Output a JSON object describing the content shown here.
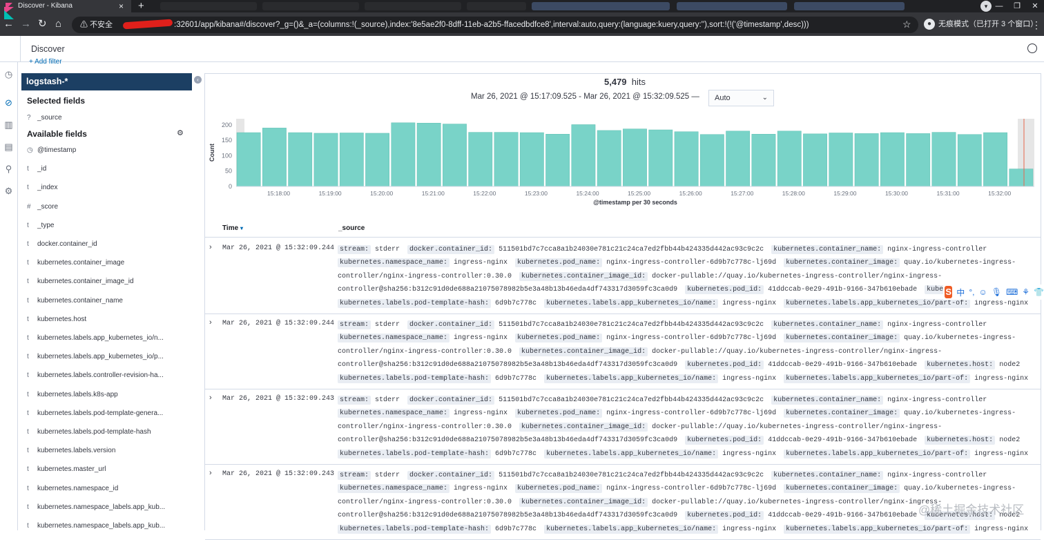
{
  "browser": {
    "tab_title": "Discover - Kibana",
    "tab_close": "×",
    "new_tab": "+",
    "window_controls": [
      "—",
      "❐",
      "✕"
    ],
    "insecure_label": "不安全",
    "url": ":32601/app/kibana#/discover?_g=()&_a=(columns:!(_source),index:'8e5ae2f0-8dff-11eb-a2b5-ffacedbdfce8',interval:auto,query:(language:kuery,query:''),sort:!(!('@timestamp',desc)))",
    "incognito_label": "无痕模式（已打开 3 个窗口）"
  },
  "app": {
    "page_title": "Discover",
    "add_filter": "+ Add filter",
    "index_pattern": "logstash-*"
  },
  "sidebar": {
    "selected_heading": "Selected fields",
    "selected_fields": [
      {
        "type": "?",
        "name": "_source"
      }
    ],
    "available_heading": "Available fields",
    "available_fields": [
      {
        "type": "◷",
        "name": "@timestamp"
      },
      {
        "type": "t",
        "name": "_id"
      },
      {
        "type": "t",
        "name": "_index"
      },
      {
        "type": "#",
        "name": "_score"
      },
      {
        "type": "t",
        "name": "_type"
      },
      {
        "type": "t",
        "name": "docker.container_id"
      },
      {
        "type": "t",
        "name": "kubernetes.container_image"
      },
      {
        "type": "t",
        "name": "kubernetes.container_image_id"
      },
      {
        "type": "t",
        "name": "kubernetes.container_name"
      },
      {
        "type": "t",
        "name": "kubernetes.host"
      },
      {
        "type": "t",
        "name": "kubernetes.labels.app_kubernetes_io/n..."
      },
      {
        "type": "t",
        "name": "kubernetes.labels.app_kubernetes_io/p..."
      },
      {
        "type": "t",
        "name": "kubernetes.labels.controller-revision-ha..."
      },
      {
        "type": "t",
        "name": "kubernetes.labels.k8s-app"
      },
      {
        "type": "t",
        "name": "kubernetes.labels.pod-template-genera..."
      },
      {
        "type": "t",
        "name": "kubernetes.labels.pod-template-hash"
      },
      {
        "type": "t",
        "name": "kubernetes.labels.version"
      },
      {
        "type": "t",
        "name": "kubernetes.master_url"
      },
      {
        "type": "t",
        "name": "kubernetes.namespace_id"
      },
      {
        "type": "t",
        "name": "kubernetes.namespace_labels.app_kub..."
      },
      {
        "type": "t",
        "name": "kubernetes.namespace_labels.app_kub..."
      }
    ]
  },
  "summary": {
    "hits_count": "5,479",
    "hits_label": "hits",
    "time_range": "Mar 26, 2021 @ 15:17:09.525 - Mar 26, 2021 @ 15:32:09.525 —",
    "interval_value": "Auto"
  },
  "chart_data": {
    "type": "bar",
    "xlabel": "@timestamp per 30 seconds",
    "ylabel": "Count",
    "ylim": [
      0,
      220
    ],
    "yticks": [
      0,
      50,
      100,
      150,
      200
    ],
    "xticks": [
      "15:18:00",
      "15:19:00",
      "15:20:00",
      "15:21:00",
      "15:22:00",
      "15:23:00",
      "15:24:00",
      "15:25:00",
      "15:26:00",
      "15:27:00",
      "15:28:00",
      "15:29:00",
      "15:30:00",
      "15:31:00",
      "15:32:00"
    ],
    "bar_color": "#54b399",
    "values": [
      175,
      190,
      175,
      173,
      174,
      173,
      207,
      206,
      203,
      176,
      176,
      175,
      170,
      201,
      182,
      187,
      184,
      178,
      169,
      180,
      170,
      180,
      171,
      174,
      172,
      175,
      172,
      176,
      169,
      175,
      57
    ]
  },
  "table": {
    "col_time": "Time",
    "col_source": "_source",
    "rows": [
      {
        "time": "Mar 26, 2021 @ 15:32:09.244",
        "host": "node2"
      },
      {
        "time": "Mar 26, 2021 @ 15:32:09.244",
        "host": "node2"
      },
      {
        "time": "Mar 26, 2021 @ 15:32:09.243",
        "host": "node2"
      },
      {
        "time": "Mar 26, 2021 @ 15:32:09.243",
        "host": "node2"
      }
    ],
    "source_pairs": [
      [
        "stream:",
        "stderr"
      ],
      [
        "docker.container_id:",
        "511501bd7c7cca8a1b24030e781c21c24ca7ed2fbb44b424335d442ac93c9c2c"
      ],
      [
        "kubernetes.container_name:",
        "nginx-ingress-controller"
      ],
      [
        "kubernetes.namespace_name:",
        "ingress-nginx"
      ],
      [
        "kubernetes.pod_name:",
        "nginx-ingress-controller-6d9b7c778c-lj69d"
      ],
      [
        "kubernetes.container_image:",
        "quay.io/kubernetes-ingress-controller/nginx-ingress-controller:0.30.0"
      ],
      [
        "kubernetes.container_image_id:",
        "docker-pullable://quay.io/kubernetes-ingress-controller/nginx-ingress-controller@sha256:b312c91d0de688a21075078982b5e3a48b13b46eda4df743317d3059fc3ca0d9"
      ],
      [
        "kubernetes.pod_id:",
        "41ddccab-0e29-491b-9166-347b610ebade"
      ],
      [
        "kubernetes.host:",
        "node2"
      ],
      [
        "kubernetes.labels.pod-template-hash:",
        "6d9b7c778c"
      ],
      [
        "kubernetes.labels.app_kubernetes_io/name:",
        "ingress-nginx"
      ],
      [
        "kubernetes.labels.app_kubernetes_io/part-of:",
        "ingress-nginx"
      ]
    ]
  },
  "overlay": {
    "ime_label": "中",
    "watermark": "@稀土掘金技术社区"
  }
}
